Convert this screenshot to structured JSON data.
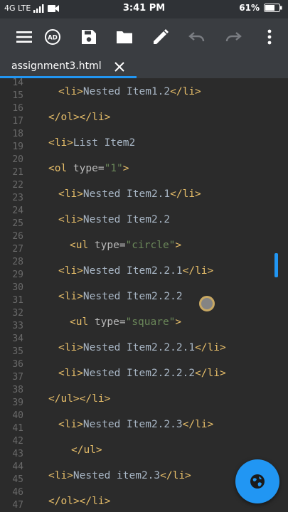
{
  "status": {
    "network": "4G LTE",
    "time": "3:41 PM",
    "battery": "61%"
  },
  "toolbar": {
    "icons": [
      "menu-icon",
      "ad-icon",
      "save-icon",
      "folder-icon",
      "edit-icon",
      "undo-icon",
      "redo-icon",
      "more-icon"
    ]
  },
  "tab": {
    "label": "assignment3.html"
  },
  "editor": {
    "line_numbers": [
      "14",
      "15",
      "16",
      "17",
      "18",
      "19",
      "20",
      "21",
      "22",
      "23",
      "24",
      "25",
      "26",
      "27",
      "28",
      "29",
      "30",
      "31",
      "32",
      "33",
      "34",
      "35",
      "36",
      "37",
      "38",
      "39",
      "40",
      "41",
      "42",
      "43",
      "44",
      "45",
      "46",
      "47"
    ],
    "lines": [
      [
        {
          "c": "tag",
          "t": "<li>"
        },
        {
          "c": "txt",
          "t": "Nested Item1.2"
        },
        {
          "c": "tag",
          "t": "</li>"
        }
      ],
      [
        {
          "c": "tag",
          "t": "</ol></li>"
        }
      ],
      [
        {
          "c": "tag",
          "t": "<li>"
        },
        {
          "c": "txt",
          "t": "List Item2"
        }
      ],
      [
        {
          "c": "tag",
          "t": "<ol "
        },
        {
          "c": "attr",
          "t": "type="
        },
        {
          "c": "val",
          "t": "\"1\""
        },
        {
          "c": "tag",
          "t": ">"
        }
      ],
      [
        {
          "c": "tag",
          "t": "<li>"
        },
        {
          "c": "txt",
          "t": "Nested Item2.1"
        },
        {
          "c": "tag",
          "t": "</li>"
        }
      ],
      [
        {
          "c": "tag",
          "t": "<li>"
        },
        {
          "c": "txt",
          "t": "Nested Item2.2"
        }
      ],
      [
        {
          "c": "tag",
          "t": "<ul "
        },
        {
          "c": "attr",
          "t": "type="
        },
        {
          "c": "val",
          "t": "\"circle\""
        },
        {
          "c": "tag",
          "t": ">"
        }
      ],
      [
        {
          "c": "tag",
          "t": "<li>"
        },
        {
          "c": "txt",
          "t": "Nested Item2.2.1"
        },
        {
          "c": "tag",
          "t": "</li>"
        }
      ],
      [
        {
          "c": "tag",
          "t": "<li>"
        },
        {
          "c": "txt",
          "t": "Nested Item2.2.2"
        }
      ],
      [
        {
          "c": "tag",
          "t": "<ul "
        },
        {
          "c": "attr",
          "t": "type="
        },
        {
          "c": "val",
          "t": "\"square\""
        },
        {
          "c": "tag",
          "t": ">"
        }
      ],
      [
        {
          "c": "tag",
          "t": "<li>"
        },
        {
          "c": "txt",
          "t": "Nested Item2.2.2.1"
        },
        {
          "c": "tag",
          "t": "</li>"
        }
      ],
      [
        {
          "c": "tag",
          "t": "<li>"
        },
        {
          "c": "txt",
          "t": "Nested Item2.2.2.2"
        },
        {
          "c": "tag",
          "t": "</li>"
        }
      ],
      [
        {
          "c": "tag",
          "t": "</ul></li>"
        }
      ],
      [
        {
          "c": "tag",
          "t": "<li>"
        },
        {
          "c": "txt",
          "t": "Nested Item2.2.3"
        },
        {
          "c": "tag",
          "t": "</li>"
        }
      ],
      [
        {
          "c": "tag",
          "t": "</ul>"
        }
      ],
      [
        {
          "c": "tag",
          "t": "<li>"
        },
        {
          "c": "txt",
          "t": "Nested item2.3"
        },
        {
          "c": "tag",
          "t": "</li>"
        }
      ],
      [
        {
          "c": "tag",
          "t": "</ol></li>"
        }
      ]
    ]
  },
  "fab": {
    "icon": "globe-icon"
  },
  "colors": {
    "accent": "#2196f3",
    "toolbar": "#3a3d41",
    "editor_bg": "#2b2b2b",
    "tag": "#e8bf6a",
    "string": "#6a8759"
  }
}
